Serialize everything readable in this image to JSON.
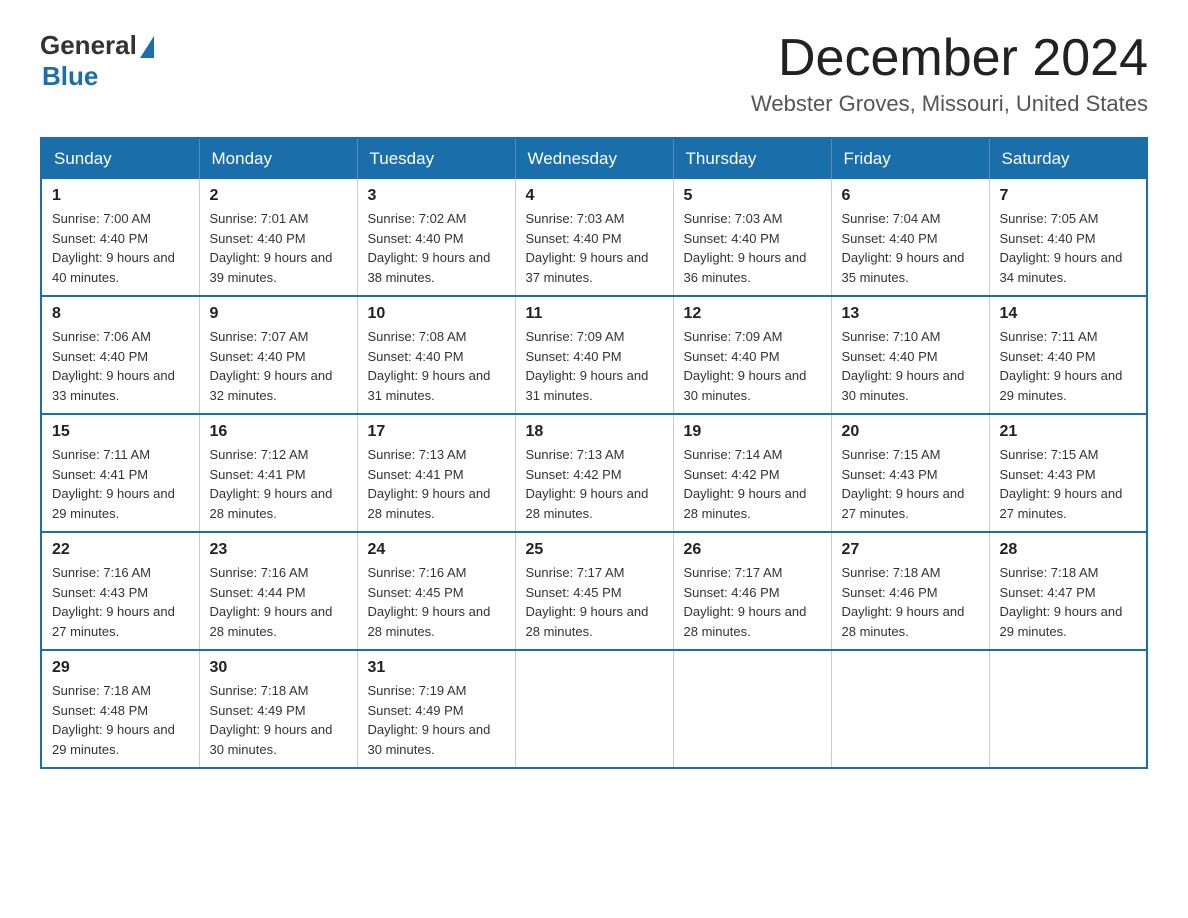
{
  "logo": {
    "general": "General",
    "blue": "Blue"
  },
  "header": {
    "title": "December 2024",
    "subtitle": "Webster Groves, Missouri, United States"
  },
  "days_of_week": [
    "Sunday",
    "Monday",
    "Tuesday",
    "Wednesday",
    "Thursday",
    "Friday",
    "Saturday"
  ],
  "weeks": [
    [
      {
        "day": "1",
        "sunrise": "7:00 AM",
        "sunset": "4:40 PM",
        "daylight": "9 hours and 40 minutes."
      },
      {
        "day": "2",
        "sunrise": "7:01 AM",
        "sunset": "4:40 PM",
        "daylight": "9 hours and 39 minutes."
      },
      {
        "day": "3",
        "sunrise": "7:02 AM",
        "sunset": "4:40 PM",
        "daylight": "9 hours and 38 minutes."
      },
      {
        "day": "4",
        "sunrise": "7:03 AM",
        "sunset": "4:40 PM",
        "daylight": "9 hours and 37 minutes."
      },
      {
        "day": "5",
        "sunrise": "7:03 AM",
        "sunset": "4:40 PM",
        "daylight": "9 hours and 36 minutes."
      },
      {
        "day": "6",
        "sunrise": "7:04 AM",
        "sunset": "4:40 PM",
        "daylight": "9 hours and 35 minutes."
      },
      {
        "day": "7",
        "sunrise": "7:05 AM",
        "sunset": "4:40 PM",
        "daylight": "9 hours and 34 minutes."
      }
    ],
    [
      {
        "day": "8",
        "sunrise": "7:06 AM",
        "sunset": "4:40 PM",
        "daylight": "9 hours and 33 minutes."
      },
      {
        "day": "9",
        "sunrise": "7:07 AM",
        "sunset": "4:40 PM",
        "daylight": "9 hours and 32 minutes."
      },
      {
        "day": "10",
        "sunrise": "7:08 AM",
        "sunset": "4:40 PM",
        "daylight": "9 hours and 31 minutes."
      },
      {
        "day": "11",
        "sunrise": "7:09 AM",
        "sunset": "4:40 PM",
        "daylight": "9 hours and 31 minutes."
      },
      {
        "day": "12",
        "sunrise": "7:09 AM",
        "sunset": "4:40 PM",
        "daylight": "9 hours and 30 minutes."
      },
      {
        "day": "13",
        "sunrise": "7:10 AM",
        "sunset": "4:40 PM",
        "daylight": "9 hours and 30 minutes."
      },
      {
        "day": "14",
        "sunrise": "7:11 AM",
        "sunset": "4:40 PM",
        "daylight": "9 hours and 29 minutes."
      }
    ],
    [
      {
        "day": "15",
        "sunrise": "7:11 AM",
        "sunset": "4:41 PM",
        "daylight": "9 hours and 29 minutes."
      },
      {
        "day": "16",
        "sunrise": "7:12 AM",
        "sunset": "4:41 PM",
        "daylight": "9 hours and 28 minutes."
      },
      {
        "day": "17",
        "sunrise": "7:13 AM",
        "sunset": "4:41 PM",
        "daylight": "9 hours and 28 minutes."
      },
      {
        "day": "18",
        "sunrise": "7:13 AM",
        "sunset": "4:42 PM",
        "daylight": "9 hours and 28 minutes."
      },
      {
        "day": "19",
        "sunrise": "7:14 AM",
        "sunset": "4:42 PM",
        "daylight": "9 hours and 28 minutes."
      },
      {
        "day": "20",
        "sunrise": "7:15 AM",
        "sunset": "4:43 PM",
        "daylight": "9 hours and 27 minutes."
      },
      {
        "day": "21",
        "sunrise": "7:15 AM",
        "sunset": "4:43 PM",
        "daylight": "9 hours and 27 minutes."
      }
    ],
    [
      {
        "day": "22",
        "sunrise": "7:16 AM",
        "sunset": "4:43 PM",
        "daylight": "9 hours and 27 minutes."
      },
      {
        "day": "23",
        "sunrise": "7:16 AM",
        "sunset": "4:44 PM",
        "daylight": "9 hours and 28 minutes."
      },
      {
        "day": "24",
        "sunrise": "7:16 AM",
        "sunset": "4:45 PM",
        "daylight": "9 hours and 28 minutes."
      },
      {
        "day": "25",
        "sunrise": "7:17 AM",
        "sunset": "4:45 PM",
        "daylight": "9 hours and 28 minutes."
      },
      {
        "day": "26",
        "sunrise": "7:17 AM",
        "sunset": "4:46 PM",
        "daylight": "9 hours and 28 minutes."
      },
      {
        "day": "27",
        "sunrise": "7:18 AM",
        "sunset": "4:46 PM",
        "daylight": "9 hours and 28 minutes."
      },
      {
        "day": "28",
        "sunrise": "7:18 AM",
        "sunset": "4:47 PM",
        "daylight": "9 hours and 29 minutes."
      }
    ],
    [
      {
        "day": "29",
        "sunrise": "7:18 AM",
        "sunset": "4:48 PM",
        "daylight": "9 hours and 29 minutes."
      },
      {
        "day": "30",
        "sunrise": "7:18 AM",
        "sunset": "4:49 PM",
        "daylight": "9 hours and 30 minutes."
      },
      {
        "day": "31",
        "sunrise": "7:19 AM",
        "sunset": "4:49 PM",
        "daylight": "9 hours and 30 minutes."
      },
      null,
      null,
      null,
      null
    ]
  ],
  "labels": {
    "sunrise": "Sunrise:",
    "sunset": "Sunset:",
    "daylight": "Daylight:"
  }
}
